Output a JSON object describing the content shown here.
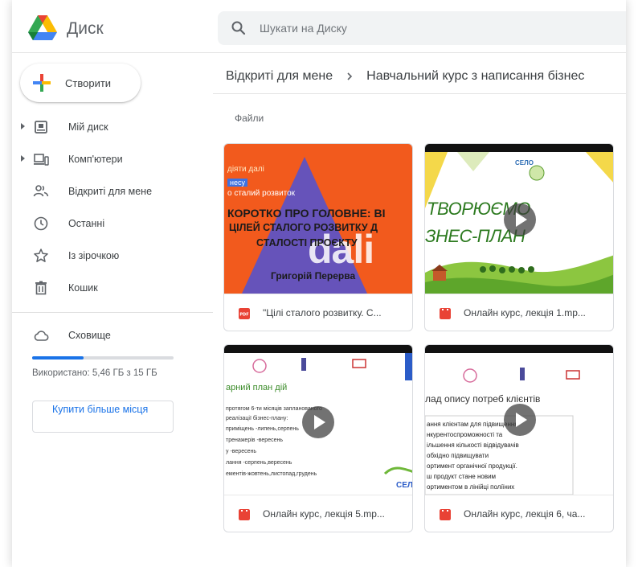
{
  "app": {
    "brand": "Диск",
    "search_placeholder": "Шукати на Диску"
  },
  "sidebar": {
    "create_label": "Створити",
    "items": [
      {
        "label": "Мій диск",
        "icon": "my-drive-icon"
      },
      {
        "label": "Комп'ютери",
        "icon": "computers-icon"
      },
      {
        "label": "Відкриті для мене",
        "icon": "shared-with-me-icon"
      },
      {
        "label": "Останні",
        "icon": "recent-clock-icon"
      },
      {
        "label": "Із зірочкою",
        "icon": "star-icon"
      },
      {
        "label": "Кошик",
        "icon": "trash-icon"
      }
    ],
    "storage": {
      "label": "Сховище",
      "icon": "cloud-icon",
      "used_text": "Використано: 5,46 ГБ з 15 ГБ",
      "used_fraction": 0.364,
      "buy_label": "Купити більше місця"
    }
  },
  "main": {
    "breadcrumb": [
      "Відкриті для мене",
      "Навчальний курс з написання бізнес"
    ],
    "section_label": "Файли",
    "files": [
      {
        "name": "\"Цілі сталого розвитку. С...",
        "type": "pdf",
        "thumb": {
          "line1": "діяти далі",
          "line2": "несу",
          "line3": "о сталий розвиток",
          "headline1": "КОРОТКО ПРО ГОЛОВНЕ: ВІ",
          "headline2": "ЦІЛЕЙ СТАЛОГО РОЗВИТКУ Д",
          "headline3": "СТАЛОСТІ ПРОЄКТУ",
          "author": "Григорій Перерва",
          "watermark": "dali"
        }
      },
      {
        "name": "Онлайн курс, лекція 1.mp...",
        "type": "video",
        "thumb": {
          "logo_text": "СЕЛО",
          "title1": "ТВОРЮЄМО",
          "title2": "ЗНЕС-ПЛАН"
        }
      },
      {
        "name": "Онлайн курс, лекція 5.mp...",
        "type": "video",
        "thumb": {
          "title": "арний план дій",
          "lines": [
            "протягом 6-ти місяців запланованого",
            "реалізації бізнес-плану:",
            "приміщень -липень,серпень",
            "тренажерів -вересень",
            "у -вересень",
            "лання -серпень,вересень",
            "ементів-жовтень,листопад,грудень"
          ],
          "corner": "СЕЛ"
        }
      },
      {
        "name": "Онлайн курс, лекція 6, ча...",
        "type": "video",
        "thumb": {
          "title": "лад опису потреб клієнтів",
          "lines": [
            "ання клієнтам для підвищення",
            "нкурентоспроможності та",
            "ільшення кількості відвідувачів",
            "обхідно підвищувати",
            "ортимент органічної продукції.",
            "ш продукт стане новим",
            "ортиментом в лінійці поліїних"
          ]
        }
      }
    ]
  }
}
